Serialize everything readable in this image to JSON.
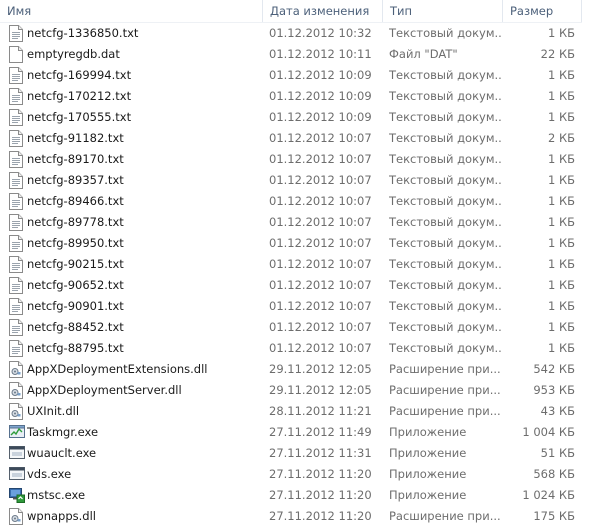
{
  "columns": {
    "name": "Имя",
    "date": "Дата изменения",
    "type": "Тип",
    "size": "Размер"
  },
  "files": [
    {
      "name": "netcfg-1336850.txt",
      "date": "01.12.2012 10:32",
      "type": "Текстовый докум...",
      "size": "1 КБ",
      "icon": "text-file-icon"
    },
    {
      "name": "emptyregdb.dat",
      "date": "01.12.2012 10:11",
      "type": "Файл \"DAT\"",
      "size": "22 КБ",
      "icon": "blank-file-icon"
    },
    {
      "name": "netcfg-169994.txt",
      "date": "01.12.2012 10:09",
      "type": "Текстовый докум...",
      "size": "1 КБ",
      "icon": "text-file-icon"
    },
    {
      "name": "netcfg-170212.txt",
      "date": "01.12.2012 10:09",
      "type": "Текстовый докум...",
      "size": "1 КБ",
      "icon": "text-file-icon"
    },
    {
      "name": "netcfg-170555.txt",
      "date": "01.12.2012 10:09",
      "type": "Текстовый докум...",
      "size": "1 КБ",
      "icon": "text-file-icon"
    },
    {
      "name": "netcfg-91182.txt",
      "date": "01.12.2012 10:07",
      "type": "Текстовый докум...",
      "size": "2 КБ",
      "icon": "text-file-icon"
    },
    {
      "name": "netcfg-89170.txt",
      "date": "01.12.2012 10:07",
      "type": "Текстовый докум...",
      "size": "1 КБ",
      "icon": "text-file-icon"
    },
    {
      "name": "netcfg-89357.txt",
      "date": "01.12.2012 10:07",
      "type": "Текстовый докум...",
      "size": "1 КБ",
      "icon": "text-file-icon"
    },
    {
      "name": "netcfg-89466.txt",
      "date": "01.12.2012 10:07",
      "type": "Текстовый докум...",
      "size": "1 КБ",
      "icon": "text-file-icon"
    },
    {
      "name": "netcfg-89778.txt",
      "date": "01.12.2012 10:07",
      "type": "Текстовый докум...",
      "size": "1 КБ",
      "icon": "text-file-icon"
    },
    {
      "name": "netcfg-89950.txt",
      "date": "01.12.2012 10:07",
      "type": "Текстовый докум...",
      "size": "1 КБ",
      "icon": "text-file-icon"
    },
    {
      "name": "netcfg-90215.txt",
      "date": "01.12.2012 10:07",
      "type": "Текстовый докум...",
      "size": "1 КБ",
      "icon": "text-file-icon"
    },
    {
      "name": "netcfg-90652.txt",
      "date": "01.12.2012 10:07",
      "type": "Текстовый докум...",
      "size": "1 КБ",
      "icon": "text-file-icon"
    },
    {
      "name": "netcfg-90901.txt",
      "date": "01.12.2012 10:07",
      "type": "Текстовый докум...",
      "size": "1 КБ",
      "icon": "text-file-icon"
    },
    {
      "name": "netcfg-88452.txt",
      "date": "01.12.2012 10:07",
      "type": "Текстовый докум...",
      "size": "1 КБ",
      "icon": "text-file-icon"
    },
    {
      "name": "netcfg-88795.txt",
      "date": "01.12.2012 10:07",
      "type": "Текстовый докум...",
      "size": "1 КБ",
      "icon": "text-file-icon"
    },
    {
      "name": "AppXDeploymentExtensions.dll",
      "date": "29.11.2012 12:05",
      "type": "Расширение при...",
      "size": "542 КБ",
      "icon": "dll-file-icon"
    },
    {
      "name": "AppXDeploymentServer.dll",
      "date": "29.11.2012 12:05",
      "type": "Расширение при...",
      "size": "953 КБ",
      "icon": "dll-file-icon"
    },
    {
      "name": "UXInit.dll",
      "date": "28.11.2012 11:21",
      "type": "Расширение при...",
      "size": "43 КБ",
      "icon": "dll-file-icon"
    },
    {
      "name": "Taskmgr.exe",
      "date": "27.11.2012 11:49",
      "type": "Приложение",
      "size": "1 004 КБ",
      "icon": "task-manager-icon"
    },
    {
      "name": "wuauclt.exe",
      "date": "27.11.2012 11:31",
      "type": "Приложение",
      "size": "51 КБ",
      "icon": "application-window-icon"
    },
    {
      "name": "vds.exe",
      "date": "27.11.2012 11:20",
      "type": "Приложение",
      "size": "568 КБ",
      "icon": "application-window-icon"
    },
    {
      "name": "mstsc.exe",
      "date": "27.11.2012 11:20",
      "type": "Приложение",
      "size": "1 024 КБ",
      "icon": "remote-desktop-icon"
    },
    {
      "name": "wpnapps.dll",
      "date": "27.11.2012 11:20",
      "type": "Расширение при...",
      "size": "175 КБ",
      "icon": "dll-file-icon"
    }
  ]
}
